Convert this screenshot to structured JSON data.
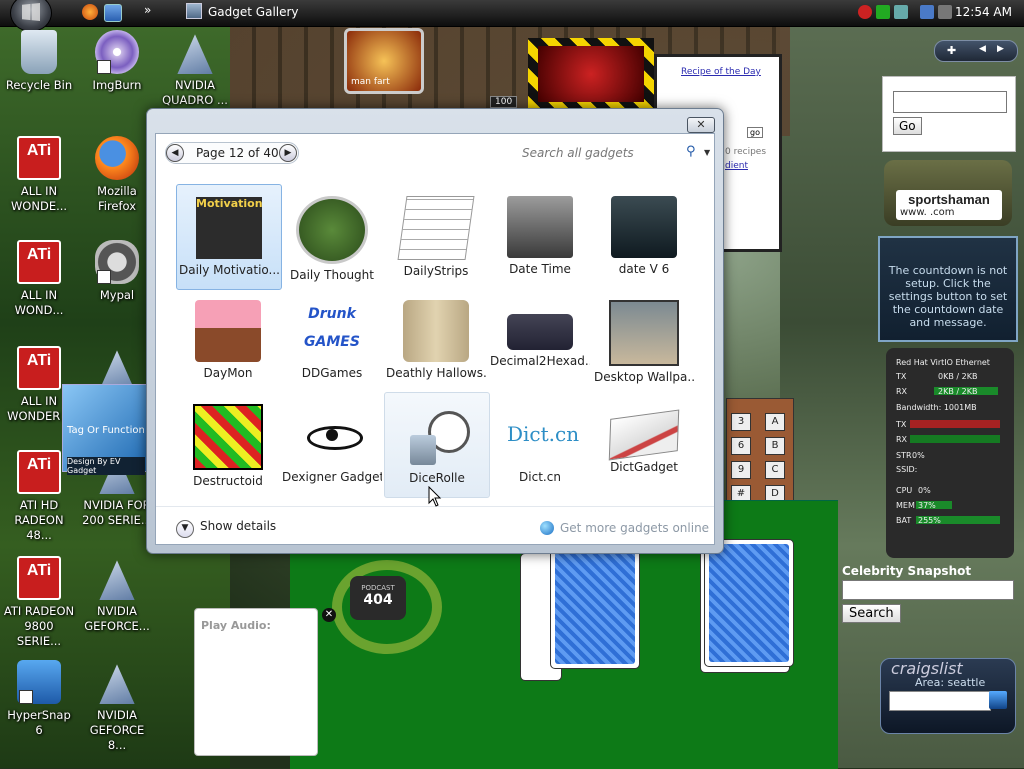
{
  "taskbar": {
    "window_title": "Gadget Gallery",
    "clock": "12:54 AM",
    "more": "»"
  },
  "desktop_icons": [
    {
      "label": "Recycle Bin",
      "icon": "recycle-bin-icon"
    },
    {
      "label": "ImgBurn",
      "icon": "imgburn-icon"
    },
    {
      "label": "NVIDIA QUADRO ...",
      "icon": "nvidia-icon"
    },
    {
      "label": "ALL IN WONDE...",
      "icon": "ati-icon"
    },
    {
      "label": "Mozilla Firefox",
      "icon": "firefox-icon"
    },
    {
      "label": "ALL IN WOND...",
      "icon": "ati-icon"
    },
    {
      "label": "Mypal",
      "icon": "mypal-icon"
    },
    {
      "label": "ALL IN WONDER P",
      "icon": "ati-icon"
    },
    {
      "label": "ATI HD RADEON 48...",
      "icon": "ati-icon"
    },
    {
      "label": "NVIDIA FOR 200 SERIE...",
      "icon": "nvidia-icon"
    },
    {
      "label": "ATI RADEON 9800 SERIE...",
      "icon": "ati-icon"
    },
    {
      "label": "NVIDIA GEFORCE...",
      "icon": "nvidia-icon"
    },
    {
      "label": "HyperSnap 6",
      "icon": "hypersnap-icon"
    },
    {
      "label": "NVIDIA GEFORCE 8...",
      "icon": "nvidia-icon"
    }
  ],
  "ati_logo_text": "ATi",
  "gallery": {
    "close": "✕",
    "page_label": "Page 12 of 40",
    "search_placeholder": "Search all gadgets",
    "show_details": "Show details",
    "get_more": "Get more gadgets online",
    "gadgets": [
      {
        "label": "Daily Motivatio...",
        "state": "selected"
      },
      {
        "label": "Daily Thought"
      },
      {
        "label": "DailyStrips"
      },
      {
        "label": "Date Time"
      },
      {
        "label": "date V 6"
      },
      {
        "label": "DayMon"
      },
      {
        "label": "DDGames"
      },
      {
        "label": "Deathly Hallows..."
      },
      {
        "label": "Decimal2Hexad..."
      },
      {
        "label": "Desktop Wallpa..."
      },
      {
        "label": "Destructoid"
      },
      {
        "label": "Dexigner Gadget"
      },
      {
        "label": "DiceRolle",
        "state": "hover"
      },
      {
        "label": "Dict.cn"
      },
      {
        "label": "DictGadget"
      }
    ],
    "motivation_thumb": "Motivation",
    "ddgames_thumb": "Drunk GAMES",
    "dictcn_thumb": "Dict.cn"
  },
  "sidebar": {
    "go_label": "Go",
    "sportshaman": {
      "name": "sportshaman",
      "url": "www.        .com"
    },
    "countdown_text": "The countdown is not setup.  Click the settings button to set the countdown date and message.",
    "netmon": {
      "adapter": "Red Hat VirtIO Ethernet",
      "tx_label": "TX",
      "tx_value": "0KB / 2KB",
      "rx_label": "RX",
      "rx_value": "2KB / 2KB",
      "bandwidth": "Bandwidth: 1001MB",
      "tx2": "TX",
      "rx2": "RX",
      "str": "STR",
      "str_value": "0%",
      "ssid": "SSID:",
      "cpu": "CPU",
      "cpu_value": "0%",
      "mem": "MEM",
      "mem_value": "37%",
      "bat": "BAT",
      "bat_value": "255%"
    },
    "celebrity_title": "Celebrity Snapshot",
    "celebrity_search": "Search",
    "craigslist": {
      "logo": "craigslist",
      "area": "Area: seattle"
    }
  },
  "gadgets_other": {
    "recipe_title": "Recipe of the Day",
    "recipe_go": "go",
    "recipe_t2": "0 recipes",
    "recipe_t3": "dient",
    "manfart": "man fart",
    "hundred": "100",
    "tag_title": "Tag Or Function",
    "tag_credit": "Design By EV   Gadget",
    "podcast_top": "PODCAST",
    "podcast_num": "404",
    "play_audio": "Play Audio:",
    "calc_keys": [
      "3",
      "A",
      "6",
      "B",
      "9",
      "C",
      "#",
      "D"
    ]
  }
}
